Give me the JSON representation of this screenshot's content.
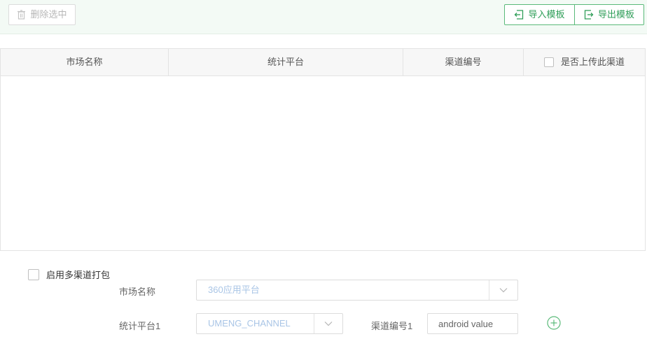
{
  "toolbar": {
    "delete_label": "删除选中",
    "import_label": "导入模板",
    "export_label": "导出模板",
    "accent_color": "#2f9e58"
  },
  "table": {
    "columns": [
      "市场名称",
      "统计平台",
      "渠道编号",
      "是否上传此渠道"
    ],
    "rows": []
  },
  "form": {
    "enable_label": "启用多渠道打包",
    "market_label": "市场名称",
    "market_value": "360应用平台",
    "platform_label": "统计平台1",
    "platform_value": "UMENG_CHANNEL",
    "channel_label": "渠道编号1",
    "channel_value": "android value"
  }
}
